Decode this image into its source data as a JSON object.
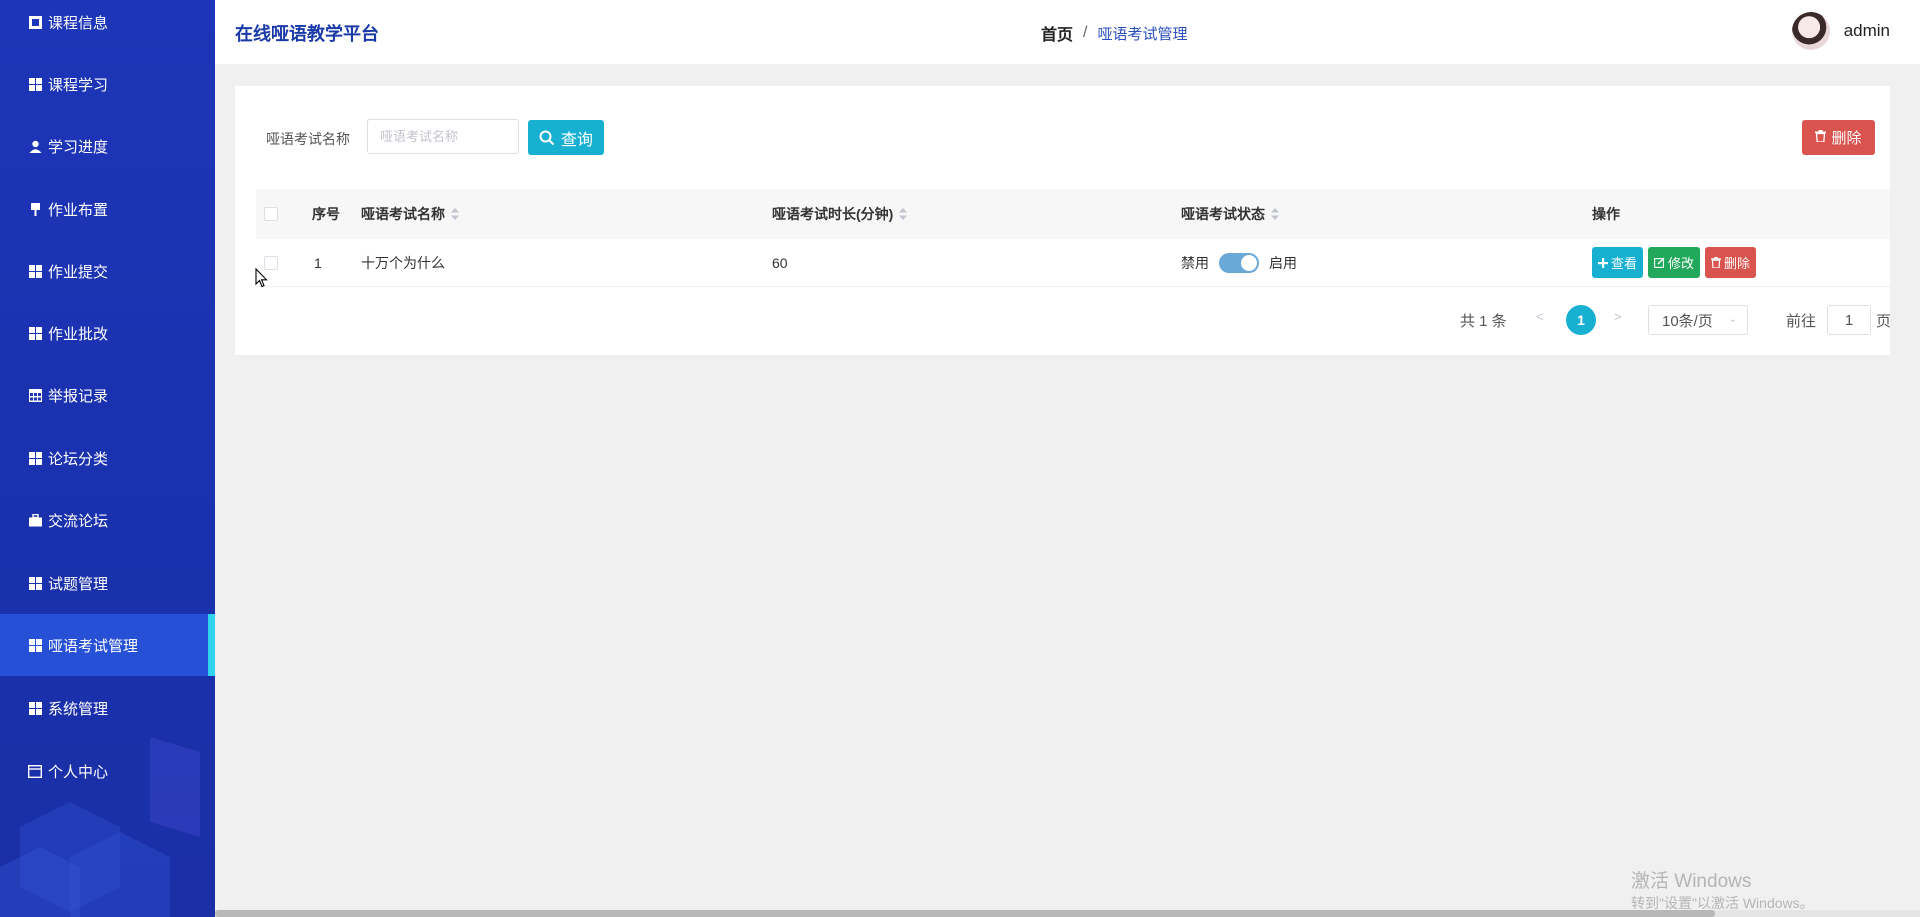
{
  "sidebar": {
    "items": [
      {
        "label": "课程信息",
        "icon": "grid-icon"
      },
      {
        "label": "课程学习",
        "icon": "grid-icon"
      },
      {
        "label": "学习进度",
        "icon": "user-icon"
      },
      {
        "label": "作业布置",
        "icon": "pin-icon"
      },
      {
        "label": "作业提交",
        "icon": "grid-icon"
      },
      {
        "label": "作业批改",
        "icon": "grid-icon"
      },
      {
        "label": "举报记录",
        "icon": "table-icon"
      },
      {
        "label": "论坛分类",
        "icon": "grid-icon"
      },
      {
        "label": "交流论坛",
        "icon": "briefcase-icon"
      },
      {
        "label": "试题管理",
        "icon": "grid-icon"
      },
      {
        "label": "哑语考试管理",
        "icon": "grid-icon",
        "active": true
      },
      {
        "label": "系统管理",
        "icon": "grid-icon"
      },
      {
        "label": "个人中心",
        "icon": "window-icon"
      }
    ]
  },
  "header": {
    "brand": "在线哑语教学平台",
    "breadcrumb": {
      "home": "首页",
      "separator": "/",
      "current": "哑语考试管理"
    },
    "user": {
      "name": "admin"
    }
  },
  "search": {
    "label": "哑语考试名称",
    "placeholder": "哑语考试名称",
    "value": "",
    "button_label": "查询"
  },
  "toolbar": {
    "delete_label": "删除"
  },
  "table": {
    "columns": {
      "index": "序号",
      "name": "哑语考试名称",
      "duration": "哑语考试时长(分钟)",
      "status": "哑语考试状态",
      "actions": "操作"
    },
    "rows": [
      {
        "index": "1",
        "name": "十万个为什么",
        "duration": "60",
        "status_off_label": "禁用",
        "status_on_label": "启用",
        "status_enabled": true
      }
    ],
    "row_actions": {
      "view": "查看",
      "edit": "修改",
      "delete": "删除"
    }
  },
  "pagination": {
    "total_text": "共 1 条",
    "current_page": "1",
    "page_size": "10条/页",
    "goto_label": "前往",
    "goto_value": "1",
    "page_suffix": "页"
  },
  "watermark": {
    "line1": "激活 Windows",
    "line2": "转到\"设置\"以激活 Windows。"
  },
  "colors": {
    "sidebar": "#1d35b8",
    "sidebar_active": "#2650d6",
    "accent": "#18b0d0",
    "danger": "#d9534f",
    "success": "#22a85a"
  }
}
